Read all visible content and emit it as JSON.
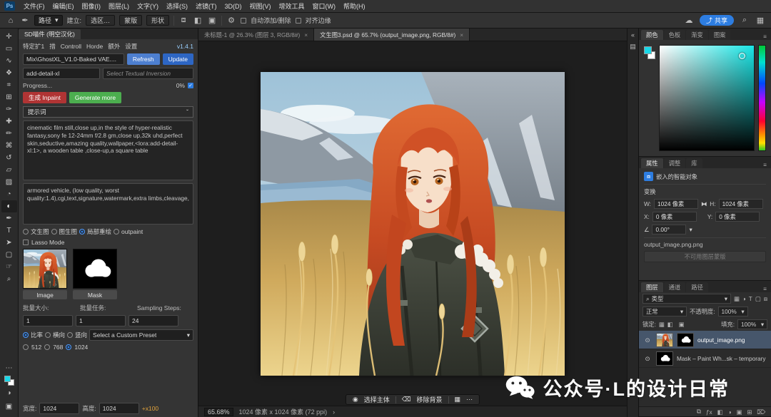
{
  "colors": {
    "accent_blue": "#2d7de1",
    "refresh_blue": "#4d7fd0",
    "update_blue": "#2d66c4",
    "inpaint_red": "#b03434",
    "generate_green": "#4cae4f",
    "note_orange": "#e0a23c",
    "picker_cyan": "#19e6e6"
  },
  "menubar": {
    "logo": "Ps",
    "items": [
      "文件(F)",
      "编辑(E)",
      "图像(I)",
      "图层(L)",
      "文字(Y)",
      "选择(S)",
      "滤镜(T)",
      "3D(D)",
      "视图(V)",
      "增效工具",
      "窗口(W)",
      "帮助(H)"
    ]
  },
  "optionsbar": {
    "tool_select": "路径",
    "make_label": "建立:",
    "buttons": [
      "选区…",
      "蒙版",
      "形状"
    ],
    "auto_add": "自动添加/删除",
    "align_edges": "对齐边缘",
    "share": "共享"
  },
  "icons": {
    "home": "⌂",
    "pen": "✒",
    "dropdown": "▾",
    "gear": "⚙",
    "cloud": "☁",
    "search": "⌕",
    "workspace": "▦",
    "share_arrow": "⤴",
    "collapse": "«",
    "history": "▤",
    "menu": "≡",
    "chevron": "ˇ",
    "check": "✓",
    "eye": "⊙",
    "chain": "⧓",
    "angle": "∠",
    "link": "⧉",
    "fx": "ƒx",
    "mask": "◧",
    "adjust": "◑",
    "group": "▣",
    "new_layer": "⊞",
    "trash": "⌦",
    "person": "◉",
    "eraser": "⌫",
    "grid": "▦",
    "more": "⋯",
    "filter_pixel": "▦",
    "filter_type": "T",
    "filter_shape": "▢",
    "filter_smart": "⧈",
    "chev_right": "›"
  },
  "tools": [
    {
      "name": "move",
      "glyph": "✛"
    },
    {
      "name": "marquee",
      "glyph": "▭"
    },
    {
      "name": "lasso",
      "glyph": "∿"
    },
    {
      "name": "quick-selection",
      "glyph": "❖"
    },
    {
      "name": "crop",
      "glyph": "⌗"
    },
    {
      "name": "frame",
      "glyph": "⊞"
    },
    {
      "name": "eyedropper",
      "glyph": "✑"
    },
    {
      "name": "healing-brush",
      "glyph": "✚"
    },
    {
      "name": "brush",
      "glyph": "✏"
    },
    {
      "name": "clone-stamp",
      "glyph": "⌘"
    },
    {
      "name": "history-brush",
      "glyph": "↺"
    },
    {
      "name": "eraser",
      "glyph": "▱"
    },
    {
      "name": "gradient",
      "glyph": "▨"
    },
    {
      "name": "blur",
      "glyph": "◔"
    },
    {
      "name": "dodge",
      "glyph": "◐"
    },
    {
      "name": "pen",
      "glyph": "✒"
    },
    {
      "name": "type",
      "glyph": "T"
    },
    {
      "name": "path-selection",
      "glyph": "➤"
    },
    {
      "name": "shape",
      "glyph": "▢"
    },
    {
      "name": "hand",
      "glyph": "☞"
    },
    {
      "name": "zoom",
      "glyph": "⌕"
    }
  ],
  "sd_panel": {
    "title": "SD喵件 (明空汉化)",
    "tabs": [
      "特定扩1",
      "措",
      "Controll",
      "Horde",
      "额外",
      "设置"
    ],
    "version": "v1.4.1",
    "model": "Mix\\GhostXL_V1.0-Baked VAE....",
    "refresh": "Refresh",
    "update": "Update",
    "embedding": "add-detail-xl",
    "embedding_select": "Select Textual Inversion",
    "progress_label": "Progress...",
    "progress_value": "0%",
    "generate_inpaint": "生成 Inpaint",
    "generate_more": "Generate more",
    "prompt_header": "提示词",
    "positive_prompt": "cinematic film still,close up,in the style of hyper-realistic fantasy,sony fe 12-24mm f/2.8 gm,close up,32k uhd,perfect skin,seductive,amazing quality,wallpaper,<lora:add-detail-xl:1>, a wooden table ,close-up,a square table",
    "negative_prompt": "armored vehicle, (low quality, worst quality:1.4),cgi,text,signature,watermark,extra limbs,cleavage,",
    "modes": [
      "文生图",
      "图生图",
      "局部重绘",
      "outpaint"
    ],
    "selected_mode": "局部重绘",
    "lasso_mode": "Lasso Mode",
    "image_label": "Image",
    "mask_label": "Mask",
    "batch_size_label": "批量大小:",
    "batch_size": "1",
    "batch_count_label": "批量任务:",
    "batch_count": "1",
    "steps_label": "Sampling Steps:",
    "steps": "24",
    "ratio_options": [
      "比率",
      "横向",
      "竖向"
    ],
    "selected_ratio": "比率",
    "preset": "Select a Custom Preset",
    "size_options": [
      "512",
      "768",
      "1024"
    ],
    "selected_size": "1024",
    "width_label": "宽度:",
    "width": "1024",
    "height_label": "高度:",
    "height": "1024",
    "scale_note": "+x100"
  },
  "doc_tabs": [
    {
      "label": "未标题-1 @ 26.3% (图层 3, RGB/8#)",
      "close": "×"
    },
    {
      "label": "文生图3.psd @ 65.7% (output_image.png, RGB/8#)",
      "close": "×"
    }
  ],
  "statusbar": {
    "zoom": "65.68%",
    "doc_info": "1024 像素 x 1024 像素 (72 ppi)"
  },
  "taskbar": {
    "select_subject": "选择主体",
    "remove_bg": "移除背景"
  },
  "color_panel": {
    "tabs": [
      "颜色",
      "色板",
      "渐变",
      "图案"
    ]
  },
  "props_panel": {
    "tabs": [
      "属性",
      "调整",
      "库"
    ],
    "object_type": "嵌入的智能对象",
    "transform_label": "变换",
    "w_label": "W:",
    "w": "1024 像素",
    "h_label": "H:",
    "h": "1024 像素",
    "x_label": "X:",
    "x": "0 像素",
    "y_label": "Y:",
    "y": "0 像素",
    "angle": "0.00°",
    "file_name": "output_image.png.png",
    "mask_note": "不可用图层蒙版"
  },
  "layers_panel": {
    "tabs": [
      "图层",
      "通道",
      "路径"
    ],
    "filter_label": "类型",
    "blend_mode": "正常",
    "opacity_label": "不透明度:",
    "opacity": "100%",
    "lock_label": "锁定:",
    "fill_label": "填充:",
    "fill": "100%",
    "layers": [
      {
        "name": "output_image.png"
      },
      {
        "name": "Mask – Paint Wh...sk – temporary"
      }
    ]
  },
  "watermark": {
    "text": "公众号·L的设计日常"
  }
}
